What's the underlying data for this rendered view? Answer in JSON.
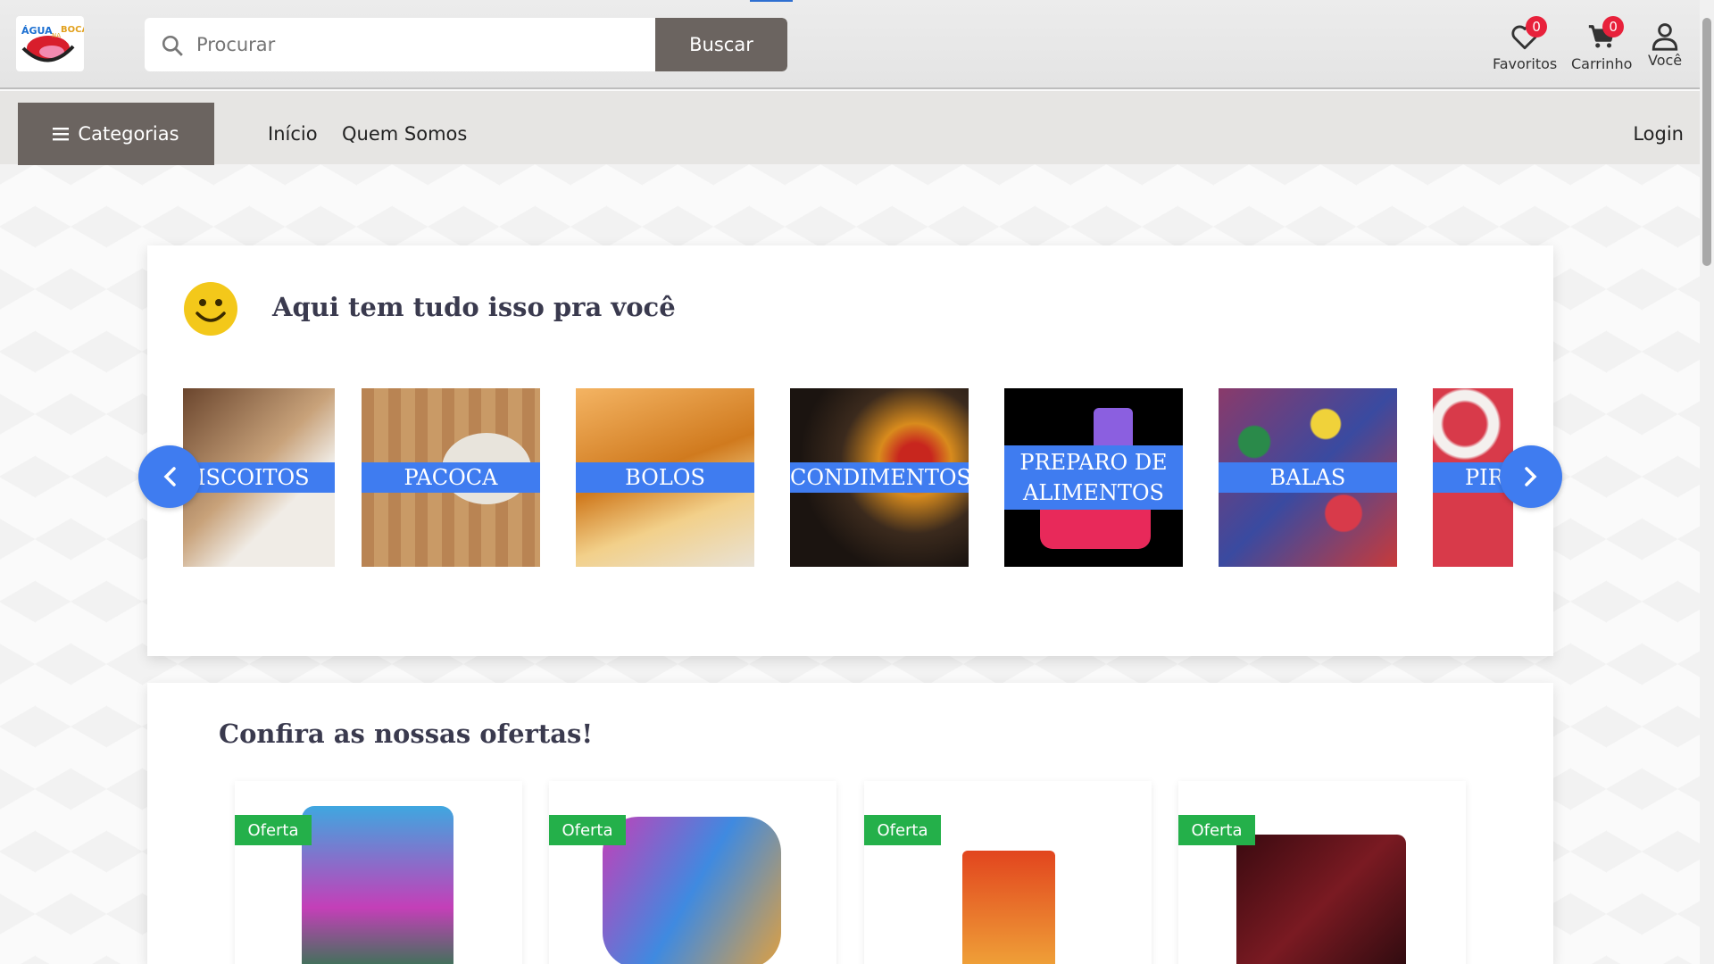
{
  "header": {
    "logo_alt": "Água na Boca",
    "search": {
      "placeholder": "Procurar",
      "button": "Buscar"
    },
    "tools": [
      {
        "label": "Favoritos",
        "badge": "0",
        "icon": "heart-icon"
      },
      {
        "label": "Carrinho",
        "badge": "0",
        "icon": "cart-icon"
      },
      {
        "label": "Você",
        "icon": "user-icon"
      }
    ]
  },
  "nav": {
    "categories_label": "Categorias",
    "links": [
      "Início",
      "Quem Somos"
    ],
    "login": "Login"
  },
  "categories_section": {
    "title": "Aqui tem tudo isso pra você",
    "items": [
      {
        "label": "BISCOITOS",
        "color": "#7a4a2a"
      },
      {
        "label": "PACOCA",
        "color": "#c99560"
      },
      {
        "label": "BOLOS",
        "color": "#d58a2b"
      },
      {
        "label": "CONDIMENTOS",
        "color": "#3b2a1d"
      },
      {
        "label": "PREPARO DE ALIMENTOS",
        "color": "#000000"
      },
      {
        "label": "BALAS",
        "color": "#8a3a6a"
      },
      {
        "label": "PIRULITOS",
        "color": "#d83a4a"
      }
    ]
  },
  "offers_section": {
    "title": "Confira as nossas ofertas!",
    "badge": "Oferta",
    "products": [
      {
        "color": "#3fa7e0"
      },
      {
        "color": "#c43fb8"
      },
      {
        "color": "#e2451e"
      },
      {
        "color": "#5a1218"
      }
    ]
  },
  "colors": {
    "accent": "#3f7cf0",
    "button": "#6b6460",
    "badge": "#e8213b",
    "offer": "#24b04a"
  }
}
